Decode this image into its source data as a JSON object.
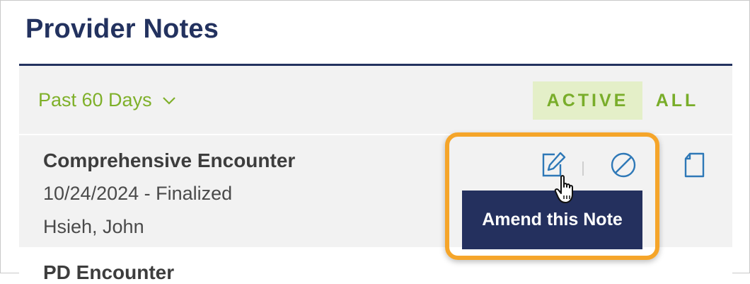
{
  "header": {
    "title": "Provider Notes"
  },
  "filters": {
    "range_label": "Past 60 Days",
    "tabs": [
      {
        "label": "ACTIVE",
        "selected": true
      },
      {
        "label": "ALL",
        "selected": false
      }
    ]
  },
  "notes": [
    {
      "title": "Comprehensive Encounter",
      "meta": "10/24/2024 - Finalized",
      "author": "Hsieh, John"
    },
    {
      "title": "PD Encounter"
    }
  ],
  "actions": {
    "amend_icon": "edit-pencil-icon",
    "void_icon": "void-circle-icon",
    "view_icon": "document-icon",
    "tooltip": "Amend this Note"
  },
  "colors": {
    "title": "#23325f",
    "accent_green": "#7fb02a",
    "active_tab_bg": "#e4efc8",
    "icon_blue": "#2e78b7",
    "tooltip_bg": "#24305e",
    "highlight": "#f5a52a"
  }
}
